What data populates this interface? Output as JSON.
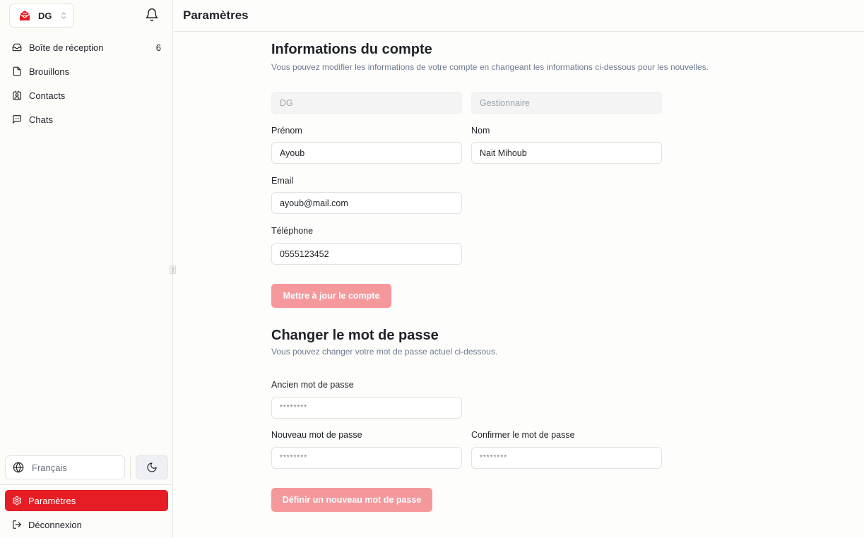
{
  "sidebar": {
    "org": {
      "label": "DG"
    },
    "items": [
      {
        "label": "Boîte de réception",
        "count": "6"
      },
      {
        "label": "Brouillons"
      },
      {
        "label": "Contacts"
      },
      {
        "label": "Chats"
      }
    ],
    "language": "Français",
    "settings_label": "Paramètres",
    "logout_label": "Déconnexion"
  },
  "header": {
    "title": "Paramètres"
  },
  "account": {
    "title": "Informations du compte",
    "subtitle": "Vous pouvez modifier les informations de votre compte en changeant les informations ci-dessous pour les nouvelles.",
    "role_short": "DG",
    "role_name": "Gestionnaire",
    "first_name_label": "Prénom",
    "first_name": "Ayoub",
    "last_name_label": "Nom",
    "last_name": "Nait Mihoub",
    "email_label": "Email",
    "email": "ayoub@mail.com",
    "phone_label": "Téléphone",
    "phone": "0555123452",
    "update_button": "Mettre à jour le compte"
  },
  "password": {
    "title": "Changer le mot de passe",
    "subtitle": "Vous pouvez changer votre mot de passe actuel ci-dessous.",
    "old_label": "Ancien mot de passe",
    "old_placeholder": "********",
    "new_label": "Nouveau mot de passe",
    "new_placeholder": "********",
    "confirm_label": "Confirmer le mot de passe",
    "confirm_placeholder": "********",
    "submit_button": "Définir un nouveau mot de passe"
  },
  "colors": {
    "accent": "#e61d25",
    "button_disabled": "#f4989c"
  }
}
